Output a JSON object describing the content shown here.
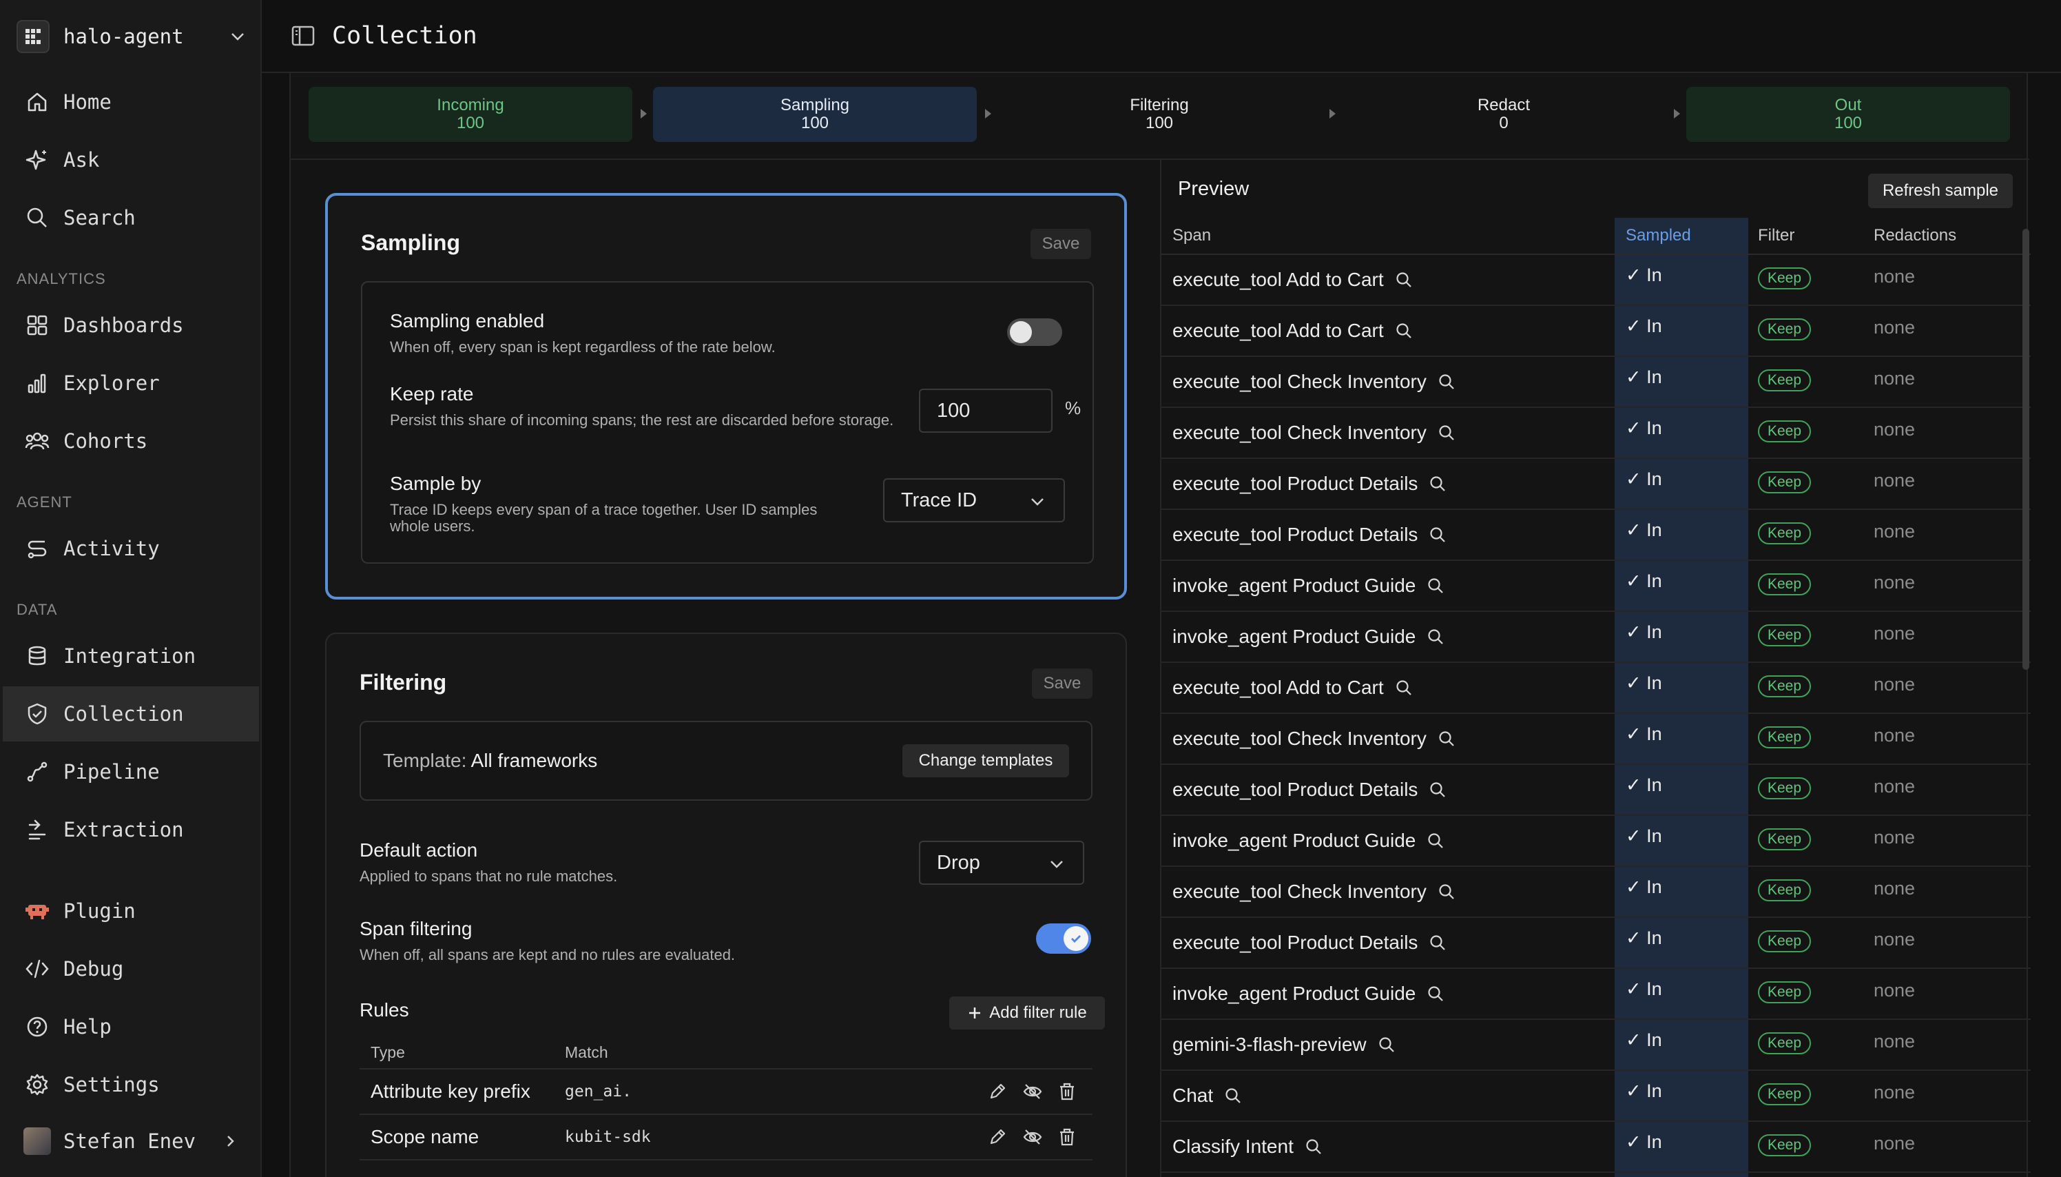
{
  "workspace": {
    "name": "halo-agent"
  },
  "sidebar": {
    "items_top": [
      {
        "label": "Home",
        "icon": "home-icon"
      },
      {
        "label": "Ask",
        "icon": "sparkle-icon"
      },
      {
        "label": "Search",
        "icon": "search-icon"
      }
    ],
    "sections": [
      {
        "title": "ANALYTICS",
        "items": [
          {
            "label": "Dashboards",
            "icon": "dashboard-icon"
          },
          {
            "label": "Explorer",
            "icon": "chart-icon"
          },
          {
            "label": "Cohorts",
            "icon": "users-icon"
          }
        ]
      },
      {
        "title": "AGENT",
        "items": [
          {
            "label": "Activity",
            "icon": "route-icon"
          }
        ]
      },
      {
        "title": "DATA",
        "items": [
          {
            "label": "Integration",
            "icon": "database-icon"
          },
          {
            "label": "Collection",
            "icon": "shield-icon",
            "active": true
          },
          {
            "label": "Pipeline",
            "icon": "pipeline-icon"
          },
          {
            "label": "Extraction",
            "icon": "extract-icon"
          }
        ]
      }
    ],
    "items_bottom": [
      {
        "label": "Plugin",
        "icon": "plugin-icon"
      },
      {
        "label": "Debug",
        "icon": "code-icon"
      },
      {
        "label": "Help",
        "icon": "help-icon"
      },
      {
        "label": "Settings",
        "icon": "gear-icon"
      }
    ],
    "user": {
      "name": "Stefan Enev"
    }
  },
  "header": {
    "title": "Collection"
  },
  "pipeline": [
    {
      "label": "Incoming",
      "count": "100",
      "style": "green"
    },
    {
      "label": "Sampling",
      "count": "100",
      "style": "blue"
    },
    {
      "label": "Filtering",
      "count": "100",
      "style": "plain"
    },
    {
      "label": "Redact",
      "count": "0",
      "style": "plain"
    },
    {
      "label": "Out",
      "count": "100",
      "style": "green"
    }
  ],
  "sampling": {
    "title": "Sampling",
    "save_label": "Save",
    "enabled": {
      "label": "Sampling enabled",
      "desc": "When off, every span is kept regardless of the rate below.",
      "on": false
    },
    "keep_rate": {
      "label": "Keep rate",
      "desc": "Persist this share of incoming spans; the rest are discarded before storage.",
      "value": "100",
      "unit": "%"
    },
    "sample_by": {
      "label": "Sample by",
      "desc": "Trace ID keeps every span of a trace together. User ID samples whole users.",
      "value": "Trace ID"
    }
  },
  "filtering": {
    "title": "Filtering",
    "save_label": "Save",
    "template_prefix": "Template:",
    "template_value": "All frameworks",
    "change_templates_label": "Change templates",
    "default_action": {
      "label": "Default action",
      "desc": "Applied to spans that no rule matches.",
      "value": "Drop"
    },
    "span_filtering": {
      "label": "Span filtering",
      "desc": "When off, all spans are kept and no rules are evaluated.",
      "on": true
    },
    "rules_title": "Rules",
    "add_rule_label": "Add filter rule",
    "columns": {
      "type": "Type",
      "match": "Match"
    },
    "rules": [
      {
        "type": "Attribute key prefix",
        "match": "gen_ai."
      },
      {
        "type": "Scope name",
        "match": "kubit-sdk"
      }
    ]
  },
  "preview": {
    "title": "Preview",
    "refresh_label": "Refresh sample",
    "columns": {
      "span": "Span",
      "sampled": "Sampled",
      "filter": "Filter",
      "redactions": "Redactions"
    },
    "rows": [
      {
        "span": "execute_tool Add to Cart",
        "sampled": "✓ In",
        "filter": "Keep",
        "redactions": "none"
      },
      {
        "span": "execute_tool Add to Cart",
        "sampled": "✓ In",
        "filter": "Keep",
        "redactions": "none"
      },
      {
        "span": "execute_tool Check Inventory",
        "sampled": "✓ In",
        "filter": "Keep",
        "redactions": "none"
      },
      {
        "span": "execute_tool Check Inventory",
        "sampled": "✓ In",
        "filter": "Keep",
        "redactions": "none"
      },
      {
        "span": "execute_tool Product Details",
        "sampled": "✓ In",
        "filter": "Keep",
        "redactions": "none"
      },
      {
        "span": "execute_tool Product Details",
        "sampled": "✓ In",
        "filter": "Keep",
        "redactions": "none"
      },
      {
        "span": "invoke_agent Product Guide",
        "sampled": "✓ In",
        "filter": "Keep",
        "redactions": "none"
      },
      {
        "span": "invoke_agent Product Guide",
        "sampled": "✓ In",
        "filter": "Keep",
        "redactions": "none"
      },
      {
        "span": "execute_tool Add to Cart",
        "sampled": "✓ In",
        "filter": "Keep",
        "redactions": "none"
      },
      {
        "span": "execute_tool Check Inventory",
        "sampled": "✓ In",
        "filter": "Keep",
        "redactions": "none"
      },
      {
        "span": "execute_tool Product Details",
        "sampled": "✓ In",
        "filter": "Keep",
        "redactions": "none"
      },
      {
        "span": "invoke_agent Product Guide",
        "sampled": "✓ In",
        "filter": "Keep",
        "redactions": "none"
      },
      {
        "span": "execute_tool Check Inventory",
        "sampled": "✓ In",
        "filter": "Keep",
        "redactions": "none"
      },
      {
        "span": "execute_tool Product Details",
        "sampled": "✓ In",
        "filter": "Keep",
        "redactions": "none"
      },
      {
        "span": "invoke_agent Product Guide",
        "sampled": "✓ In",
        "filter": "Keep",
        "redactions": "none"
      },
      {
        "span": "gemini-3-flash-preview",
        "sampled": "✓ In",
        "filter": "Keep",
        "redactions": "none"
      },
      {
        "span": "Chat",
        "sampled": "✓ In",
        "filter": "Keep",
        "redactions": "none"
      },
      {
        "span": "Classify Intent",
        "sampled": "✓ In",
        "filter": "Keep",
        "redactions": "none"
      }
    ]
  }
}
